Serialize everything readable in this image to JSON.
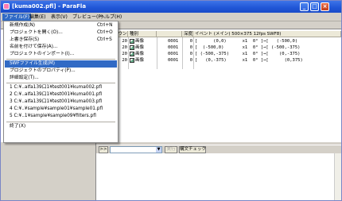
{
  "window": {
    "title": "[kuma002.pfl] - ParaFla",
    "minimize_icon": "minimize-icon",
    "maximize_icon": "maximize-icon",
    "close_icon": "close-icon"
  },
  "menubar": {
    "items": [
      {
        "label": "ファイル(F)",
        "active": true
      },
      {
        "label": "編集(E)"
      },
      {
        "label": "表示(V)"
      },
      {
        "label": "プレビュー(P)"
      },
      {
        "label": "ヘルプ(H)"
      }
    ]
  },
  "file_menu": {
    "items": [
      {
        "label": "新規作成(N)",
        "shortcut": "Ctrl+N"
      },
      {
        "label": "プロジェクトを開く(O)...",
        "shortcut": "Ctrl+O"
      },
      {
        "label": "上書き保存(S)",
        "shortcut": "Ctrl+S"
      },
      {
        "label": "名前を付けて保存(A)..."
      },
      {
        "label": "プロジェクトのインポート(I)..."
      },
      {
        "label": "SWFファイル生成(M)",
        "highlighted": true
      },
      {
        "label": "プロジェクトのプロパティ(P)..."
      },
      {
        "label": "詳細設定(T)..."
      },
      {
        "label": "1 C:¥..alfa139口1¥test001¥kuma002.pfl"
      },
      {
        "label": "2 C:¥..alfa139口1¥test001¥kuma001.pfl"
      },
      {
        "label": "3 C:¥..alfa139口1¥test001¥kuma003.pfl"
      },
      {
        "label": "4 C:¥..¥sample¥sample01¥sample01.pfl"
      },
      {
        "label": "5 C:¥..1¥sample¥sample09¥filters.pfl"
      },
      {
        "label": "終了(X)"
      }
    ]
  },
  "grid": {
    "headers": [
      "カウント",
      "種別",
      "",
      "深度",
      "イベント (メイン) 500×375 12fps SWF8)"
    ],
    "rows": [
      {
        "count": "20",
        "type": "画像",
        "id": "0001",
        "depth": "0",
        "event": "[      (0,0)      x1  0° ]→[   (-500,0)"
      },
      {
        "count": "20",
        "type": "画像",
        "id": "0001",
        "depth": "0",
        "event": "[  (-500,0)       x1  0° ]→[ (-500,-375)"
      },
      {
        "count": "20",
        "type": "画像",
        "id": "0001",
        "depth": "0",
        "event": "[ (-500,-375)     x1  0° ]→[    (0,-375)"
      },
      {
        "count": "20",
        "type": "画像",
        "id": "0001",
        "depth": "0",
        "event": "[   (0,-375)      x1  0° ]→[      (0,375)"
      }
    ]
  },
  "bottombar": {
    "prefix": ">>",
    "execute_label": "実行",
    "syntax_check_label": "構文チェック"
  },
  "colors": {
    "titlebar": "#1f55d6",
    "selection": "#316ac5"
  }
}
